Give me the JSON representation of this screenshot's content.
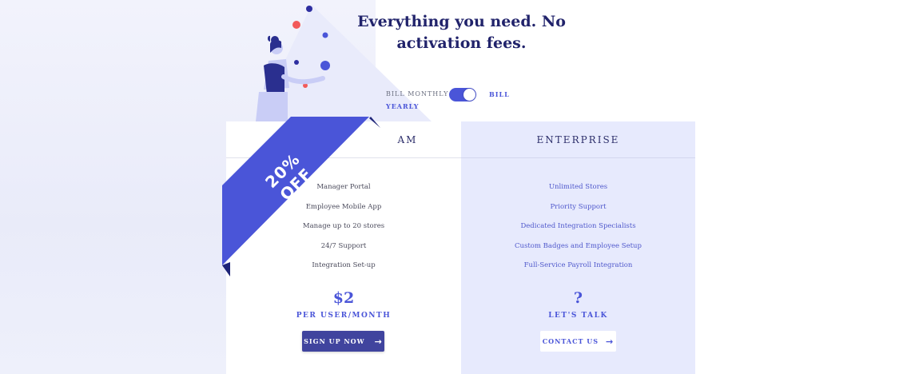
{
  "headline": "Everything you need. No activation fees.",
  "billing_toggle": {
    "monthly_label": "BILL MONTHLY",
    "yearly_label_1": "BILL",
    "yearly_label_2": "YEARLY",
    "selected": "yearly"
  },
  "promo_ribbon": "20% OFF",
  "plans": [
    {
      "title": "TEAM",
      "visible_title_fragment": "AM",
      "features": [
        "Manager Portal",
        "Employee Mobile App",
        "Manage up to 20 stores",
        "24/7 Support",
        "Integration Set-up"
      ],
      "price": "$2",
      "price_unit": "PER USER/MONTH",
      "cta_label": "SIGN UP NOW"
    },
    {
      "title": "ENTERPRISE",
      "features": [
        "Unlimited Stores",
        "Priority Support",
        "Dedicated Integration Specialists",
        "Custom Badges and Employee Setup",
        "Full-Service Payroll Integration"
      ],
      "price": "?",
      "price_unit": "LET'S TALK",
      "cta_label": "CONTACT US"
    }
  ],
  "colors": {
    "accent": "#4a55d8",
    "navy": "#21236b",
    "button_dark": "#40449e",
    "enterprise_bg": "#e7eafd"
  }
}
